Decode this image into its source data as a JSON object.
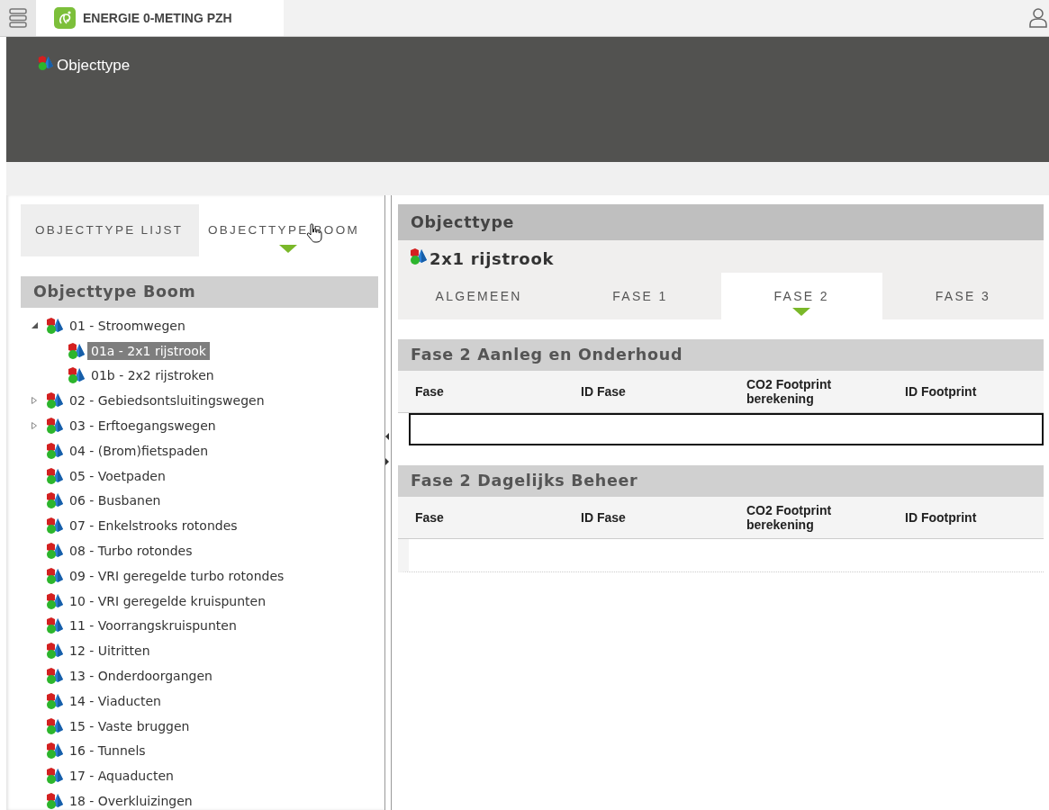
{
  "app_tab": {
    "title": "ENERGIE 0-METING PZH"
  },
  "header": {
    "title": "Objecttype"
  },
  "left_tabs": [
    {
      "label": "OBJECTTYPE LIJST",
      "selected": false
    },
    {
      "label": "OBJECTTYPE BOOM",
      "selected": true
    }
  ],
  "tree": {
    "title": "Objecttype Boom",
    "items": [
      {
        "label": "01 - Stroomwegen",
        "selected": false,
        "expanded": true,
        "children": [
          {
            "label": "01a - 2x1 rijstrook",
            "selected": true
          },
          {
            "label": "01b - 2x2 rijstroken",
            "selected": false
          }
        ]
      },
      {
        "label": "02 - Gebiedsontsluitingswegen",
        "selected": false,
        "expanded": false
      },
      {
        "label": "03 - Erftoegangswegen",
        "selected": false,
        "expanded": false
      },
      {
        "label": "04 - (Brom)fietspaden",
        "selected": false
      },
      {
        "label": "05 - Voetpaden",
        "selected": false
      },
      {
        "label": "06 - Busbanen",
        "selected": false
      },
      {
        "label": "07 - Enkelstrooks rotondes",
        "selected": false
      },
      {
        "label": "08 - Turbo rotondes",
        "selected": false
      },
      {
        "label": "09 - VRI geregelde turbo rotondes",
        "selected": false
      },
      {
        "label": "10 - VRI geregelde kruispunten",
        "selected": false
      },
      {
        "label": "11 - Voorrangskruispunten",
        "selected": false
      },
      {
        "label": "12 - Uitritten",
        "selected": false
      },
      {
        "label": "13 - Onderdoorgangen",
        "selected": false
      },
      {
        "label": "14 - Viaducten",
        "selected": false
      },
      {
        "label": "15 - Vaste bruggen",
        "selected": false
      },
      {
        "label": "16 - Tunnels",
        "selected": false
      },
      {
        "label": "17 - Aquaducten",
        "selected": false
      },
      {
        "label": "18 - Overkluizingen",
        "selected": false
      }
    ]
  },
  "detail": {
    "title": "Objecttype",
    "object_name": "2x1 rijstrook",
    "tabs": [
      {
        "label": "ALGEMEEN",
        "selected": false
      },
      {
        "label": "FASE 1",
        "selected": false
      },
      {
        "label": "FASE 2",
        "selected": true
      },
      {
        "label": "FASE 3",
        "selected": false
      }
    ],
    "tables": [
      {
        "title": "Fase 2 Aanleg en Onderhoud",
        "columns": [
          "Fase",
          "ID Fase",
          "CO2 Footprint berekening",
          "ID Footprint"
        ],
        "row_focused": true
      },
      {
        "title": "Fase 2 Dagelijks Beheer",
        "columns": [
          "Fase",
          "ID Fase",
          "CO2 Footprint berekening",
          "ID Footprint"
        ],
        "row_focused": false
      }
    ]
  }
}
